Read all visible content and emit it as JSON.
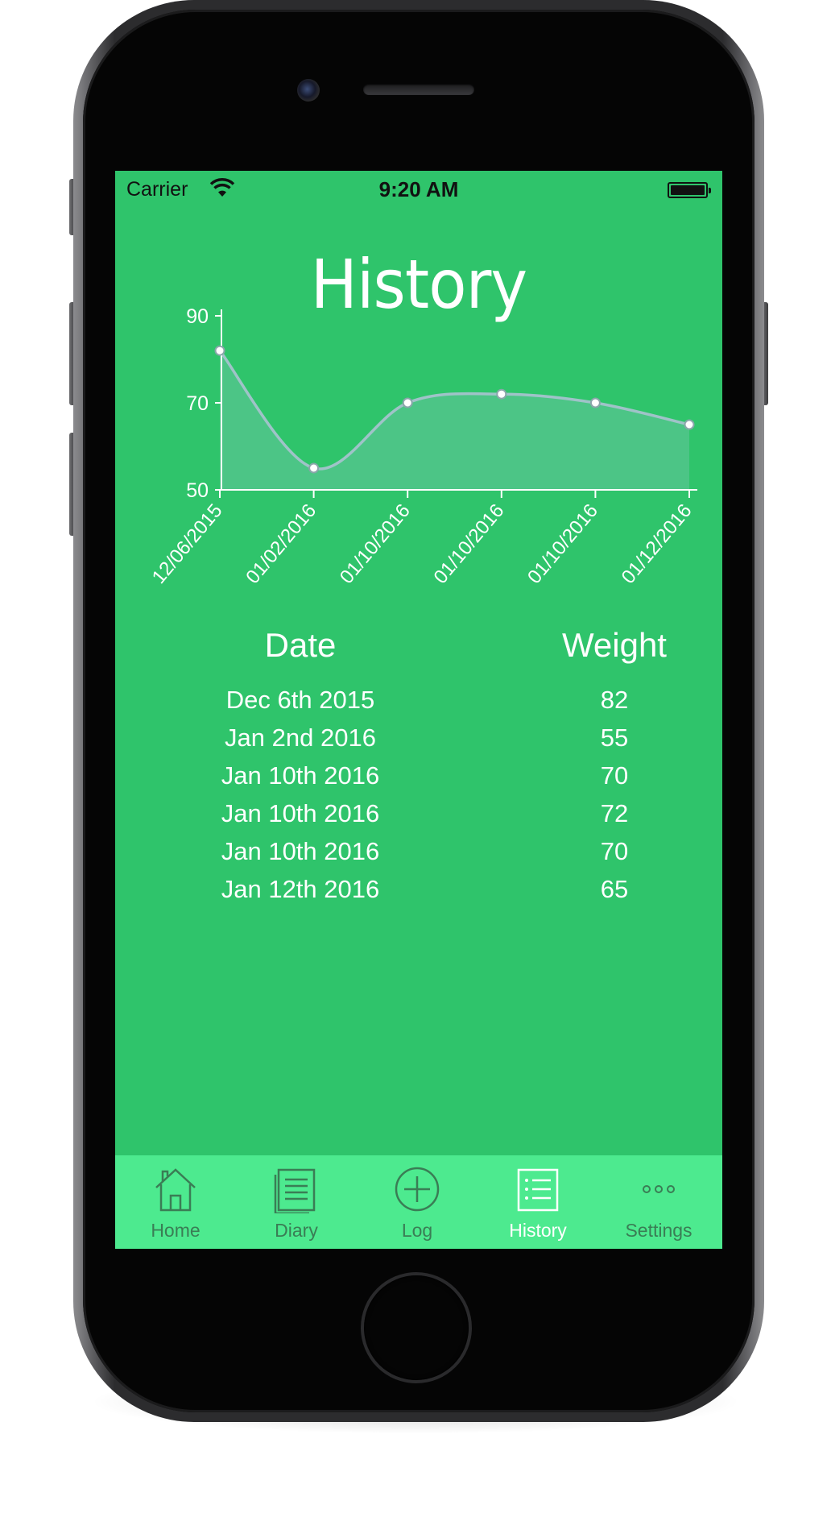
{
  "status_bar": {
    "carrier": "Carrier",
    "time": "9:20 AM"
  },
  "page": {
    "title": "History"
  },
  "chart_data": {
    "type": "area",
    "categories": [
      "12/06/2015",
      "01/02/2016",
      "01/10/2016",
      "01/10/2016",
      "01/10/2016",
      "01/12/2016"
    ],
    "values": [
      82,
      55,
      70,
      72,
      70,
      65
    ],
    "yticks": [
      50,
      70,
      90
    ],
    "ylim": [
      50,
      90
    ],
    "line_color": "#9fc3c8",
    "fill_color": "#4cc586",
    "grid": false
  },
  "table": {
    "headers": {
      "date": "Date",
      "weight": "Weight"
    },
    "rows": [
      {
        "date": "Dec 6th 2015",
        "weight": "82"
      },
      {
        "date": "Jan 2nd 2016",
        "weight": "55"
      },
      {
        "date": "Jan 10th 2016",
        "weight": "70"
      },
      {
        "date": "Jan 10th 2016",
        "weight": "72"
      },
      {
        "date": "Jan 10th 2016",
        "weight": "70"
      },
      {
        "date": "Jan 12th 2016",
        "weight": "65"
      }
    ]
  },
  "tab_bar": {
    "active": "history",
    "items": [
      {
        "id": "home",
        "label": "Home",
        "icon": "home-icon"
      },
      {
        "id": "diary",
        "label": "Diary",
        "icon": "diary-icon"
      },
      {
        "id": "log",
        "label": "Log",
        "icon": "plus-circle-icon"
      },
      {
        "id": "history",
        "label": "History",
        "icon": "list-icon"
      },
      {
        "id": "settings",
        "label": "Settings",
        "icon": "more-icon"
      }
    ]
  },
  "colors": {
    "screen_background": "#2fc46b",
    "tab_bar_background": "#4dea8f",
    "tab_label_inactive": "#3a7d55",
    "tab_label_active": "#ffffff"
  }
}
